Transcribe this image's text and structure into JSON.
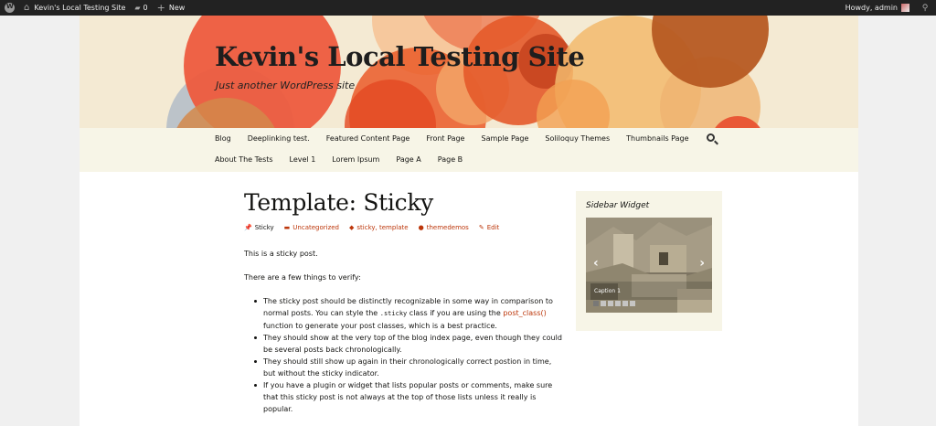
{
  "adminbar": {
    "site_name": "Kevin's Local Testing Site",
    "comments_count": "0",
    "new_label": "New",
    "howdy": "Howdy, admin"
  },
  "site": {
    "title": "Kevin's Local Testing Site",
    "description": "Just another WordPress site"
  },
  "nav": {
    "row1": [
      "Blog",
      "Deeplinking test.",
      "Featured Content Page",
      "Front Page",
      "Sample Page",
      "Soliloquy Themes",
      "Thumbnails Page"
    ],
    "row2": [
      "About The Tests",
      "Level 1",
      "Lorem Ipsum",
      "Page A",
      "Page B"
    ]
  },
  "post": {
    "title": "Template: Sticky",
    "meta": {
      "sticky": "Sticky",
      "category": "Uncategorized",
      "tags": "sticky, template",
      "author": "themedemos",
      "edit": "Edit"
    },
    "p1": "This is a sticky post.",
    "p2": "There are a few things to verify:",
    "li1_a": "The sticky post should be distinctly recognizable in some way in comparison to normal posts. You can style the ",
    "li1_code": ".sticky",
    "li1_b": " class if you are using the ",
    "li1_link": "post_class()",
    "li1_c": " function to generate your post classes, which is a best practice.",
    "li2": "They should show at the very top of the blog index page, even though they could be several posts back chronologically.",
    "li3": "They should still show up again in their chronologically correct postion in time, but without the sticky indicator.",
    "li4": "If you have a plugin or widget that lists popular posts or comments, make sure that this sticky post is not always at the top of those lists unless it really is popular."
  },
  "sidebar": {
    "widget_title": "Sidebar Widget",
    "caption": "Caption 1",
    "prev": "‹",
    "next": "›"
  },
  "colors": {
    "adminbar": "#222222",
    "accent_link": "#bc360a",
    "nav_bg": "#f7f5e7",
    "widget_bg": "#f7f5e7"
  }
}
